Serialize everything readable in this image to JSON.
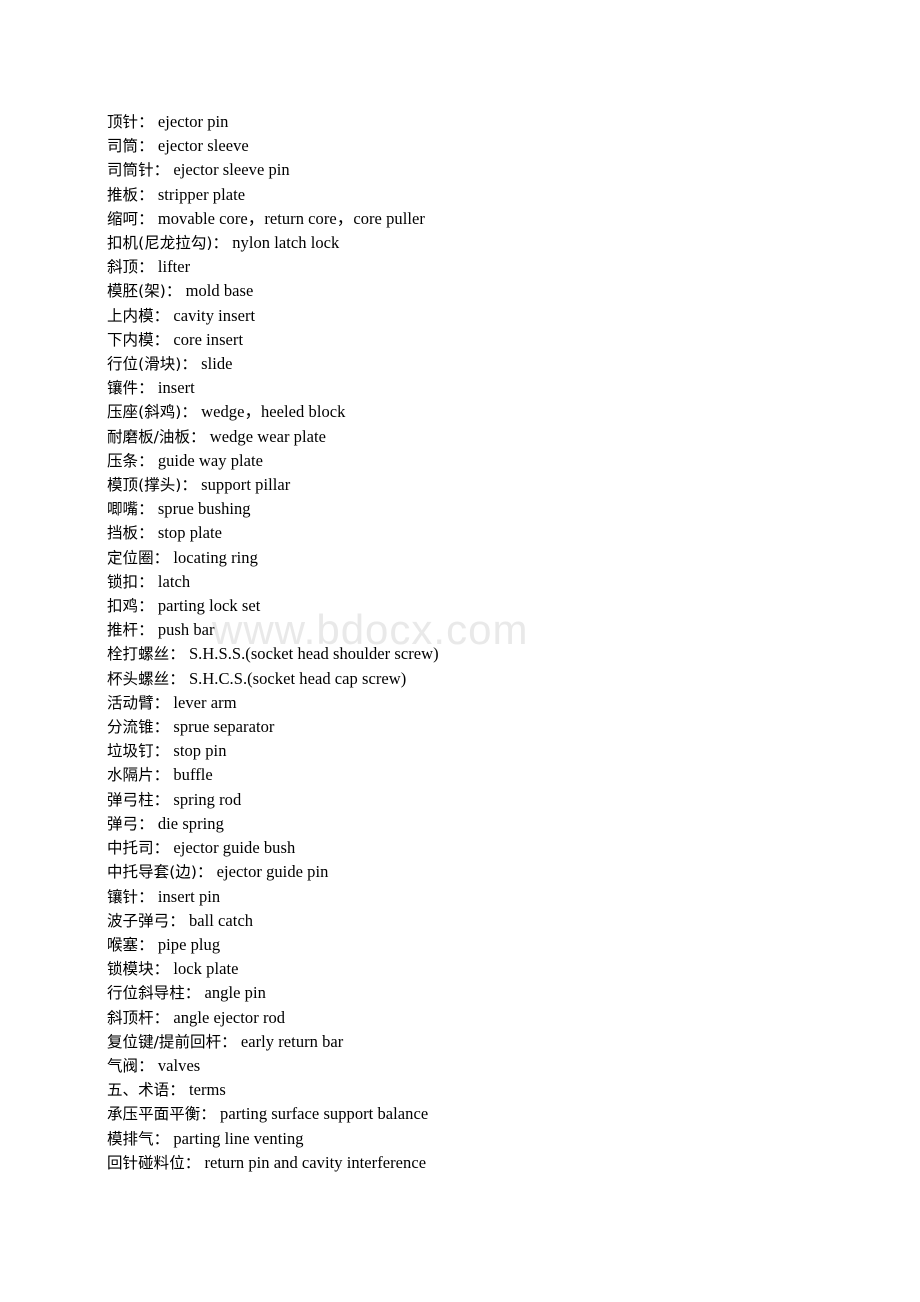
{
  "document": {
    "type": "glossary",
    "language": "zh-en",
    "watermark": "www.bdocx.com",
    "watermark_color": "#e9e9e9",
    "text_color": "#000000",
    "background_color": "#ffffff",
    "entries": [
      {
        "term": "顶针",
        "sep": "：",
        "gloss": "ejector pin"
      },
      {
        "term": "司筒",
        "sep": "：",
        "gloss": "ejector sleeve"
      },
      {
        "term": "司筒针",
        "sep": "：",
        "gloss": "ejector sleeve pin"
      },
      {
        "term": "推板",
        "sep": "：",
        "gloss": "stripper plate"
      },
      {
        "term": "缩呵",
        "sep": "：",
        "gloss": "movable core，return core，core puller"
      },
      {
        "term": "扣机(尼龙拉勾)",
        "sep": "：",
        "gloss": "nylon latch lock"
      },
      {
        "term": "斜顶",
        "sep": "：",
        "gloss": "lifter"
      },
      {
        "term": "模胚(架)",
        "sep": "：",
        "gloss": "mold base"
      },
      {
        "term": "上内模",
        "sep": "：",
        "gloss": "cavity insert"
      },
      {
        "term": "下内模",
        "sep": "：",
        "gloss": "core insert"
      },
      {
        "term": "行位(滑块)",
        "sep": "：",
        "gloss": "slide"
      },
      {
        "term": "镶件",
        "sep": "：",
        "gloss": "insert"
      },
      {
        "term": "压座(斜鸡)",
        "sep": "：",
        "gloss": "wedge，heeled block"
      },
      {
        "term": "耐磨板/油板",
        "sep": "：",
        "gloss": "wedge wear plate"
      },
      {
        "term": "压条",
        "sep": "：",
        "gloss": "guide way plate"
      },
      {
        "term": "模顶(撑头)",
        "sep": "：",
        "gloss": "support pillar"
      },
      {
        "term": "唧嘴",
        "sep": "：",
        "gloss": "sprue bushing"
      },
      {
        "term": "挡板",
        "sep": "：",
        "gloss": "stop plate"
      },
      {
        "term": "定位圈",
        "sep": "：",
        "gloss": "locating ring"
      },
      {
        "term": "锁扣",
        "sep": "：",
        "gloss": "latch"
      },
      {
        "term": "扣鸡",
        "sep": "：",
        "gloss": "parting lock set"
      },
      {
        "term": "推杆",
        "sep": "：",
        "gloss": "push bar"
      },
      {
        "term": "栓打螺丝",
        "sep": "：",
        "gloss": "S.H.S.S.(socket head shoulder screw)"
      },
      {
        "term": "杯头螺丝",
        "sep": "：",
        "gloss": "S.H.C.S.(socket head cap screw)"
      },
      {
        "term": "活动臂",
        "sep": "：",
        "gloss": "lever arm"
      },
      {
        "term": "分流锥",
        "sep": "：",
        "gloss": "sprue separator"
      },
      {
        "term": "垃圾钉",
        "sep": "：",
        "gloss": "stop pin"
      },
      {
        "term": "水隔片",
        "sep": "：",
        "gloss": "buffle"
      },
      {
        "term": "弹弓柱",
        "sep": "：",
        "gloss": "spring rod"
      },
      {
        "term": "弹弓",
        "sep": "：",
        "gloss": "die spring"
      },
      {
        "term": "中托司",
        "sep": "：",
        "gloss": "ejector guide bush"
      },
      {
        "term": "中托导套(边)",
        "sep": "：",
        "gloss": "ejector guide pin"
      },
      {
        "term": "镶针",
        "sep": "：",
        "gloss": "insert pin"
      },
      {
        "term": "波子弹弓",
        "sep": "：",
        "gloss": "ball catch"
      },
      {
        "term": "喉塞",
        "sep": "：",
        "gloss": "pipe plug"
      },
      {
        "term": "锁模块",
        "sep": "：",
        "gloss": "lock plate"
      },
      {
        "term": "行位斜导柱",
        "sep": "：",
        "gloss": "angle pin"
      },
      {
        "term": "斜顶杆",
        "sep": "：",
        "gloss": "angle ejector rod"
      },
      {
        "term": "复位键/提前回杆",
        "sep": "：",
        "gloss": "early return bar"
      },
      {
        "term": "气阀",
        "sep": "：",
        "gloss": "valves"
      },
      {
        "term": "五、术语",
        "sep": "：",
        "gloss": "terms"
      },
      {
        "term": "承压平面平衡",
        "sep": "：",
        "gloss": "parting surface support balance"
      },
      {
        "term": "模排气",
        "sep": "：",
        "gloss": "parting line venting"
      },
      {
        "term": "回针碰料位",
        "sep": "：",
        "gloss": "return pin and cavity interference"
      }
    ]
  }
}
